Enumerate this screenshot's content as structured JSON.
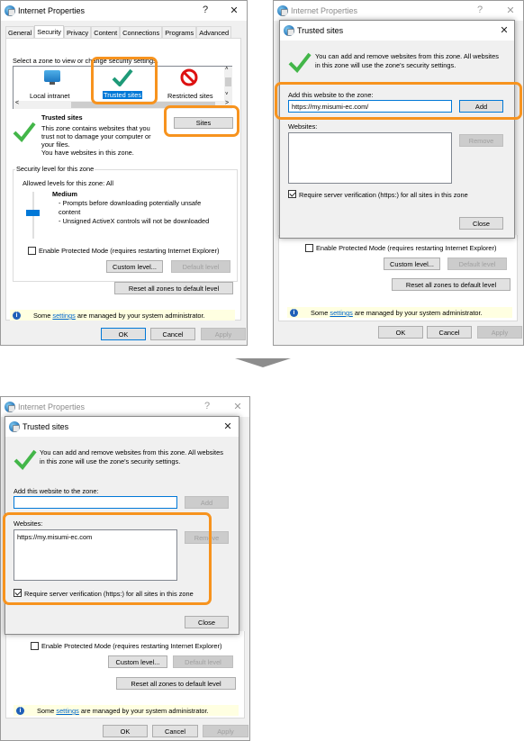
{
  "panel1": {
    "title": "Internet Properties",
    "help": "?",
    "close": "✕",
    "tabs": [
      "General",
      "Security",
      "Privacy",
      "Content",
      "Connections",
      "Programs",
      "Advanced"
    ],
    "active_tab": "Security",
    "zone_prompt": "Select a zone to view or change security settings.",
    "zones": [
      {
        "label": "Local intranet",
        "icon": "monitor-globe-icon"
      },
      {
        "label": "Trusted sites",
        "icon": "checkmark-icon",
        "selected": true
      },
      {
        "label": "Restricted sites",
        "icon": "prohibited-icon"
      }
    ],
    "zone_heading": "Trusted sites",
    "zone_desc": [
      "This zone contains websites that you",
      "trust not to damage your computer or",
      "your files.",
      "You have websites in this zone."
    ],
    "sites_button": "Sites",
    "security_group_label": "Security level for this zone",
    "allowed_levels": "Allowed levels for this zone: All",
    "level_name": "Medium",
    "level_desc": [
      "- Prompts before downloading potentially unsafe",
      "content",
      "- Unsigned ActiveX controls will not be downloaded"
    ],
    "protected_mode": "Enable Protected Mode (requires restarting Internet Explorer)",
    "protected_mode_checked": false,
    "custom_level": "Custom level...",
    "default_level": "Default level",
    "reset_all": "Reset all zones to default level",
    "info_pre": "Some ",
    "info_link": "settings",
    "info_post": " are managed by your system administrator.",
    "ok": "OK",
    "cancel": "Cancel",
    "apply": "Apply"
  },
  "panel2": {
    "parent_title": "Internet Properties",
    "title": "Trusted sites",
    "close": "✕",
    "help": "?",
    "intro": [
      "You can add and remove websites from this zone. All websites",
      "in this zone will use the zone's security settings."
    ],
    "add_label": "Add this website to the zone:",
    "add_value": "https://my.misumi-ec.com/",
    "add_button": "Add",
    "websites_label": "Websites:",
    "websites": [],
    "remove_button": "Remove",
    "require_https": "Require server verification (https:) for all sites in this zone",
    "require_https_checked": true,
    "close_button": "Close"
  },
  "panel3": {
    "parent_title": "Internet Properties",
    "title": "Trusted sites",
    "close": "✕",
    "help": "?",
    "intro": [
      "You can add and remove websites from this zone. All websites",
      "in this zone will use the zone's security settings."
    ],
    "add_label": "Add this website to the zone:",
    "add_value": "",
    "add_button": "Add",
    "websites_label": "Websites:",
    "websites": [
      "https://my.misumi-ec.com"
    ],
    "remove_button": "Remove",
    "require_https": "Require server verification (https:) for all sites in this zone",
    "require_https_checked": true,
    "close_button": "Close"
  },
  "colors": {
    "highlight": "#f7931e",
    "accent": "#0078d7",
    "check_green": "#3cb043"
  }
}
